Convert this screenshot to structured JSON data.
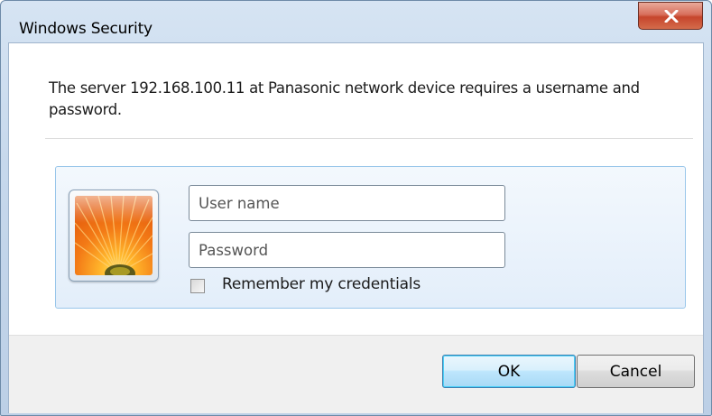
{
  "window": {
    "title": "Windows Security",
    "close_label": "X"
  },
  "dialog": {
    "message": "The server 192.168.100.11 at Panasonic network device requires a username and password."
  },
  "credentials": {
    "username_placeholder": "User name",
    "username_value": "",
    "password_placeholder": "Password",
    "password_value": "",
    "remember_label": "Remember my credentials",
    "remember_checked": false
  },
  "buttons": {
    "ok_label": "OK",
    "cancel_label": "Cancel"
  },
  "icons": {
    "user_tile": "user-account-picture-icon",
    "close": "close-icon",
    "checkbox": "checkbox-icon"
  },
  "colors": {
    "title_bar": "#c6d8ec",
    "close_button": "#c6452c",
    "panel_border": "#99c6ea",
    "default_button_border": "#3c7fb1"
  }
}
